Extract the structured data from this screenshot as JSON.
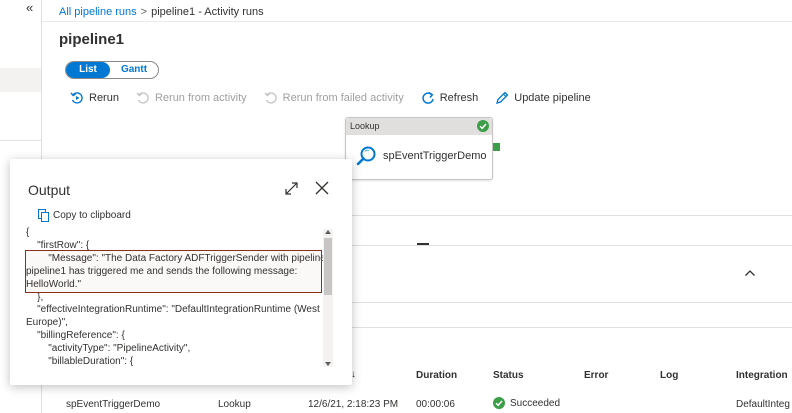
{
  "breadcrumb": {
    "root": "All pipeline runs",
    "separator": ">",
    "current": "pipeline1 - Activity runs"
  },
  "page_title": "pipeline1",
  "view_toggle": {
    "list": "List",
    "gantt": "Gantt"
  },
  "toolbar": {
    "rerun": "Rerun",
    "rerun_from_activity": "Rerun from activity",
    "rerun_from_failed_activity": "Rerun from failed activity",
    "refresh": "Refresh",
    "update_pipeline": "Update pipeline"
  },
  "canvas_node": {
    "type": "Lookup",
    "name": "spEventTriggerDemo",
    "status": "succeeded"
  },
  "output_panel": {
    "title": "Output",
    "copy_label": "Copy to clipboard",
    "lines": [
      "{",
      "    \"firstRow\": {",
      "        \"Message\": \"The Data Factory ADFTriggerSender with pipeline",
      "pipeline1 has triggered me and sends the following message:",
      "HelloWorld.\"",
      "    },",
      "    \"effectiveIntegrationRuntime\": \"DefaultIntegrationRuntime (West",
      "Europe)\",",
      "    \"billingReference\": {",
      "        \"activityType\": \"PipelineActivity\",",
      "        \"billableDuration\": {"
    ]
  },
  "table": {
    "headers": {
      "duration": "Duration",
      "status": "Status",
      "error": "Error",
      "log": "Log",
      "integration": "Integration"
    },
    "sort_arrow": "↓",
    "rows": [
      {
        "name": "spEventTriggerDemo",
        "type": "Lookup",
        "start": "12/6/21, 2:18:23 PM",
        "duration": "00:00:06",
        "status": "Succeeded",
        "integration": "DefaultInteg"
      }
    ]
  },
  "colors": {
    "accent": "#0078d4",
    "success": "#3c9e49",
    "highlight_border": "#8b2e1e"
  }
}
